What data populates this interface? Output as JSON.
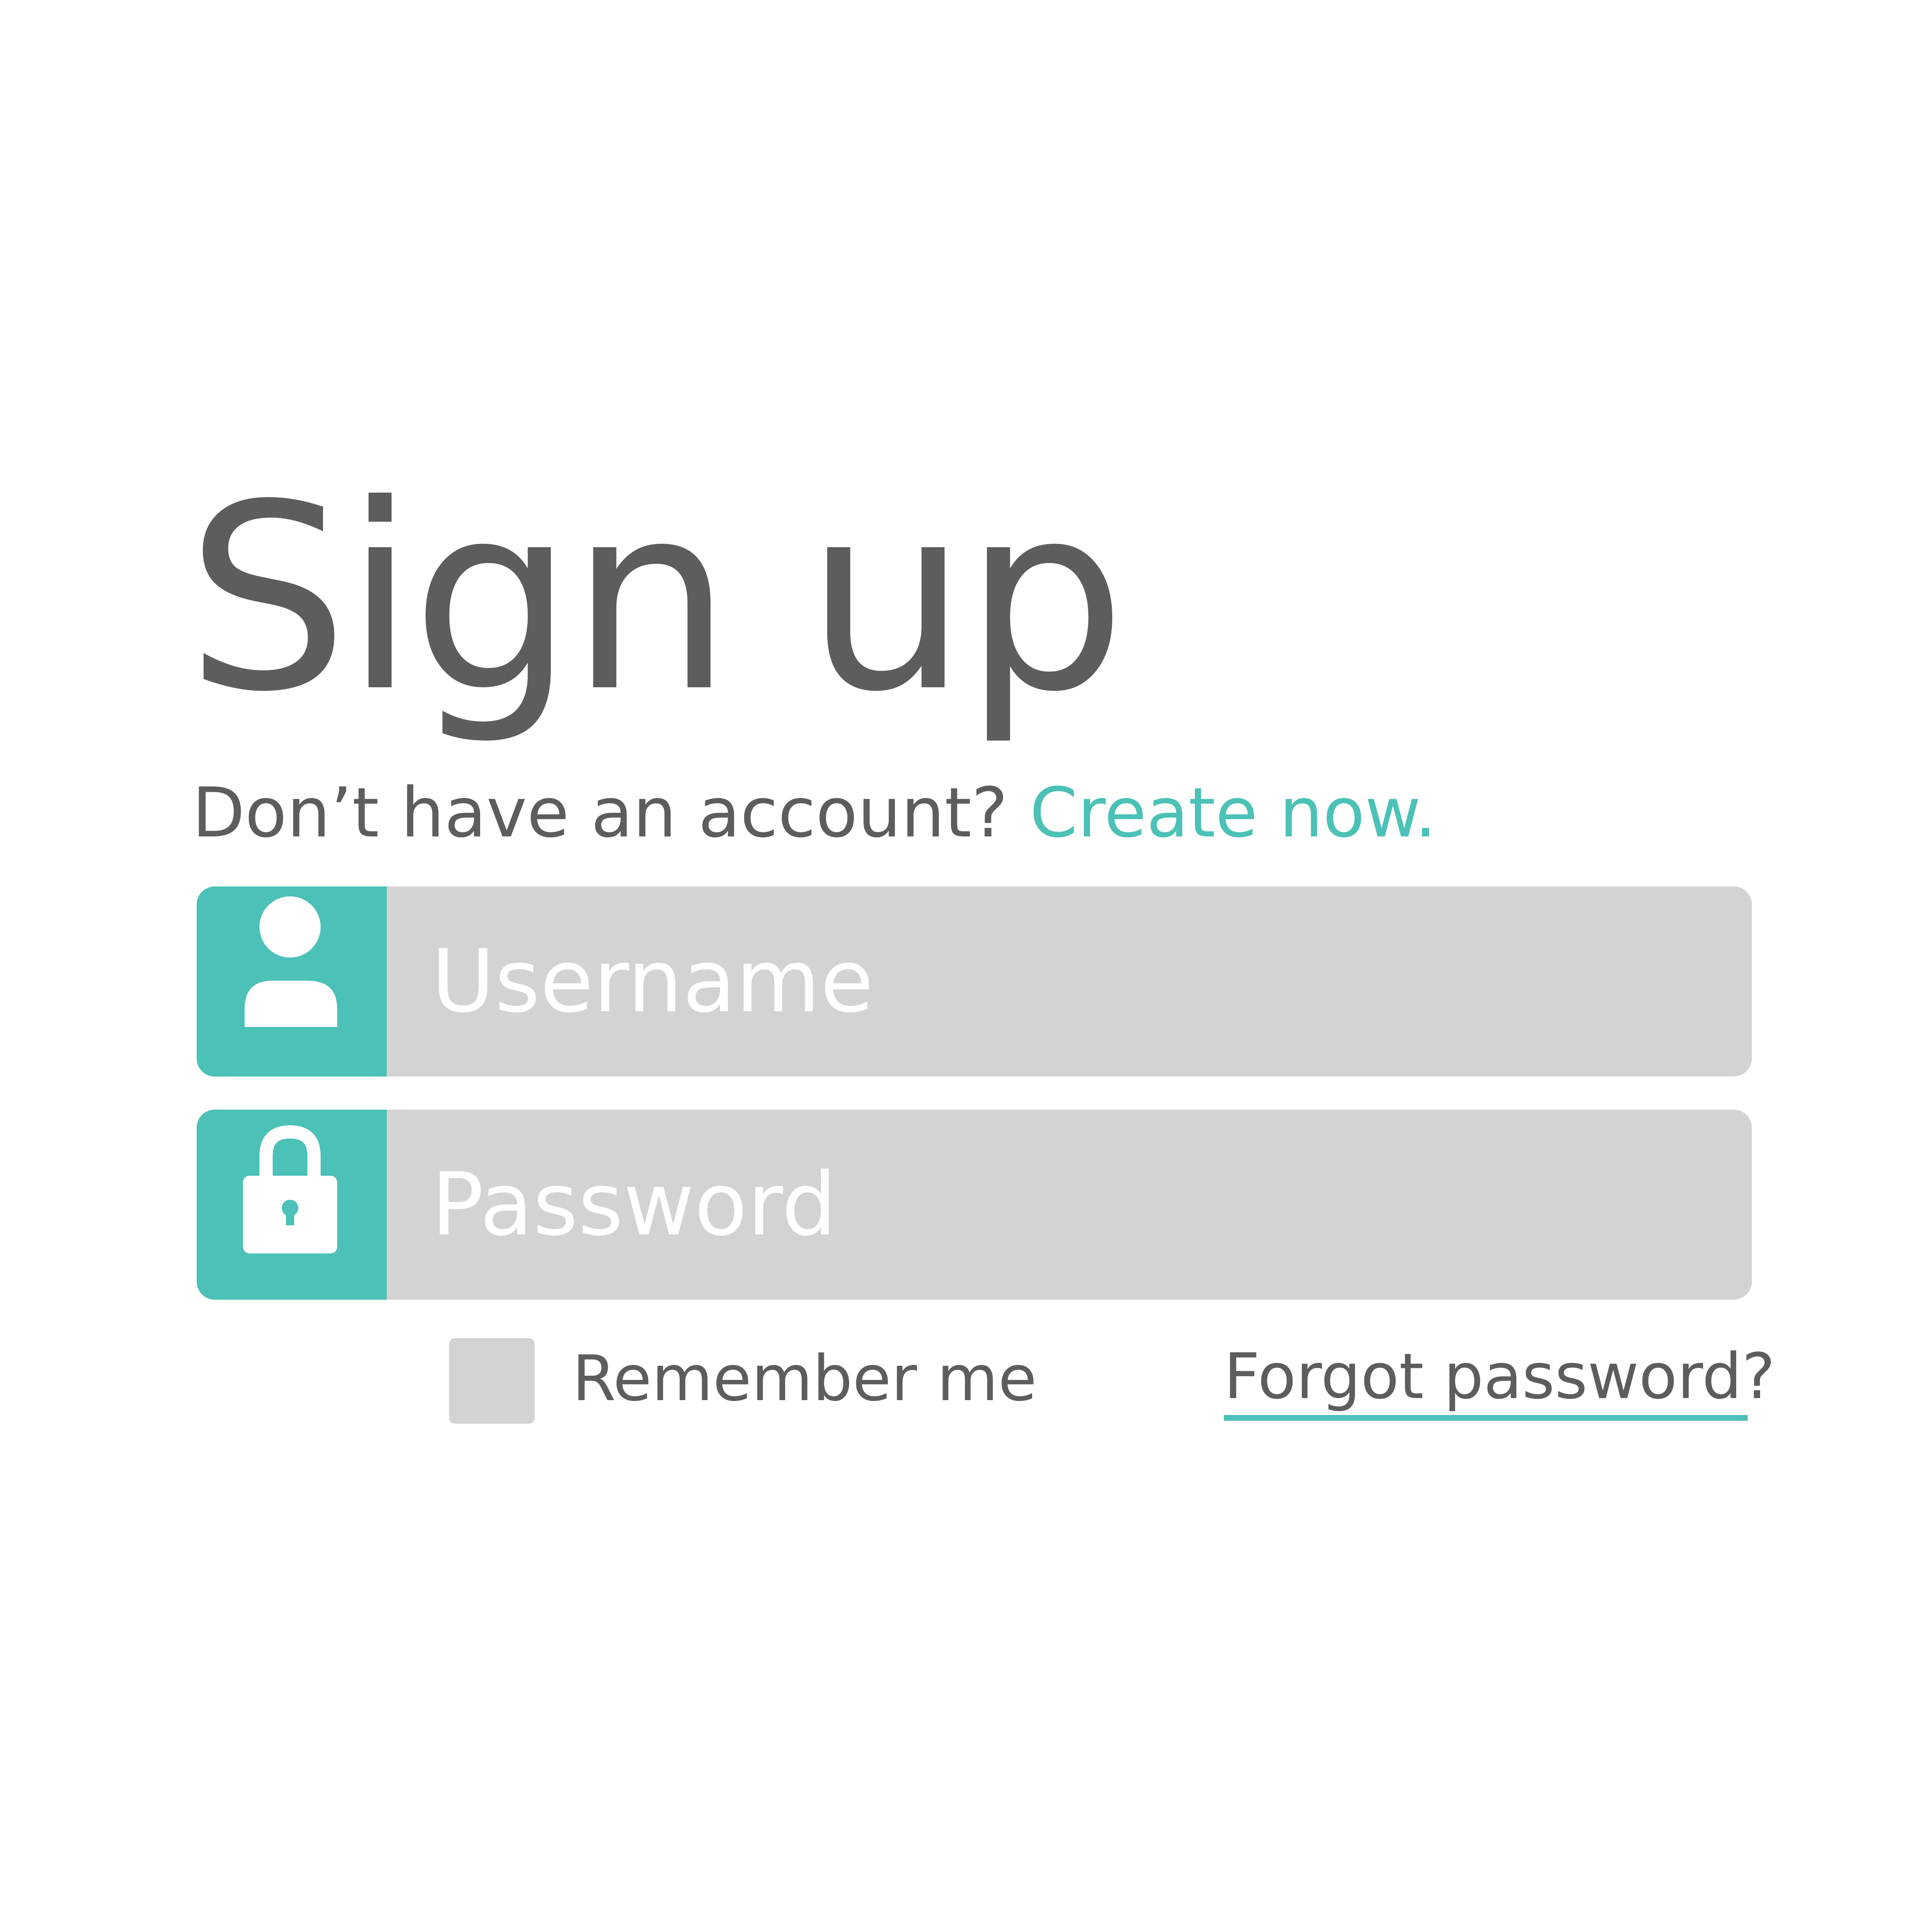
{
  "colors": {
    "accent": "#4bc1b7",
    "text": "#5d5d5d",
    "field_background": "#d3d3d3",
    "background": "#ffffff"
  },
  "header": {
    "title": "Sign up",
    "subtitle_prefix": "Don’t have an account?",
    "create_link": "Create now."
  },
  "form": {
    "username": {
      "icon": "user-icon",
      "placeholder": "Username"
    },
    "password": {
      "icon": "lock-icon",
      "placeholder": "Password"
    },
    "remember_label": "Remember me",
    "remember_checked": false,
    "forgot_link": "Forgot password?"
  }
}
